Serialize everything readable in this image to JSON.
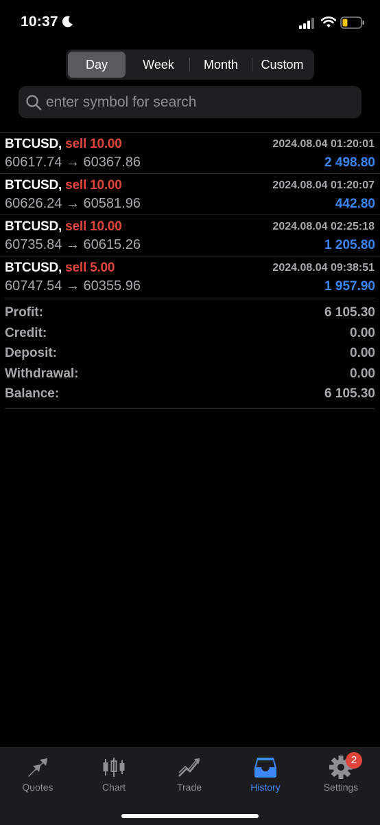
{
  "status_bar": {
    "time": "10:37",
    "moon_icon": "moon-icon",
    "signal_icon": "cellular-signal-icon",
    "wifi_icon": "wifi-icon",
    "battery_icon": "battery-low-icon",
    "battery_color": "#f5c400"
  },
  "period_tabs": [
    {
      "label": "Day",
      "active": true
    },
    {
      "label": "Week",
      "active": false
    },
    {
      "label": "Month",
      "active": false
    },
    {
      "label": "Custom",
      "active": false
    }
  ],
  "search": {
    "placeholder": "enter symbol for search",
    "value": ""
  },
  "deals": [
    {
      "symbol": "BTCUSD,",
      "side": "sell 10.00",
      "time": "2024.08.04 01:20:01",
      "prices": "60617.74 → 60367.86",
      "profit": "2 498.80"
    },
    {
      "symbol": "BTCUSD,",
      "side": "sell 10.00",
      "time": "2024.08.04 01:20:07",
      "prices": "60626.24 → 60581.96",
      "profit": "442.80"
    },
    {
      "symbol": "BTCUSD,",
      "side": "sell 10.00",
      "time": "2024.08.04 02:25:18",
      "prices": "60735.84 → 60615.26",
      "profit": "1 205.80"
    },
    {
      "symbol": "BTCUSD,",
      "side": "sell 5.00",
      "time": "2024.08.04 09:38:51",
      "prices": "60747.54 → 60355.96",
      "profit": "1 957.90"
    }
  ],
  "summary": [
    {
      "label": "Profit:",
      "value": "6 105.30"
    },
    {
      "label": "Credit:",
      "value": "0.00"
    },
    {
      "label": "Deposit:",
      "value": "0.00"
    },
    {
      "label": "Withdrawal:",
      "value": "0.00"
    },
    {
      "label": "Balance:",
      "value": "6 105.30"
    }
  ],
  "tabbar": {
    "items": [
      {
        "label": "Quotes",
        "icon": "quotes-arrows-icon",
        "active": false
      },
      {
        "label": "Chart",
        "icon": "candlestick-chart-icon",
        "active": false
      },
      {
        "label": "Trade",
        "icon": "trade-line-icon",
        "active": false
      },
      {
        "label": "History",
        "icon": "history-inbox-icon",
        "active": true
      },
      {
        "label": "Settings",
        "icon": "gear-icon",
        "active": false,
        "badge": "2"
      }
    ]
  },
  "colors": {
    "accent_blue": "#3d86f6",
    "sell_red": "#e0453c",
    "muted_text": "#a8a8ad",
    "background": "#000000"
  }
}
